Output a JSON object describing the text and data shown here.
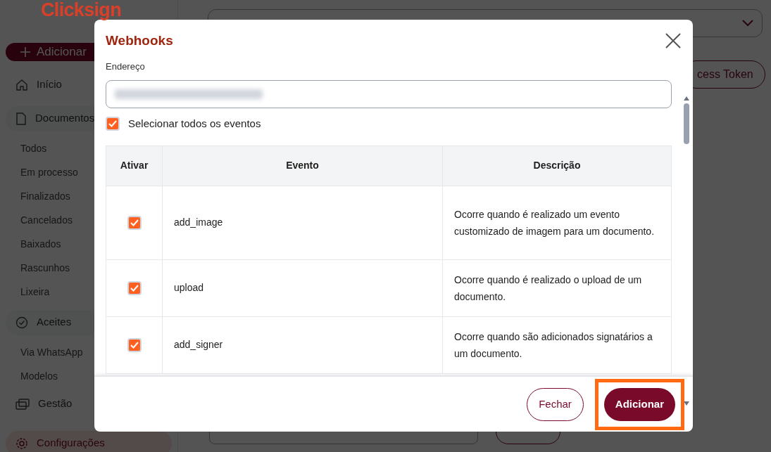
{
  "sidebar": {
    "logo": "Clicksign",
    "add_button": "Adicionar",
    "items": [
      {
        "kind": "link",
        "label": "Início",
        "selected": false
      },
      {
        "kind": "section",
        "label": "Documentos",
        "selected": false
      },
      {
        "kind": "sub",
        "label": "Todos",
        "selected": false
      },
      {
        "kind": "sub",
        "label": "Em processo",
        "selected": false
      },
      {
        "kind": "sub",
        "label": "Finalizados",
        "selected": false
      },
      {
        "kind": "sub",
        "label": "Cancelados",
        "selected": false
      },
      {
        "kind": "sub",
        "label": "Baixados",
        "selected": false
      },
      {
        "kind": "sub",
        "label": "Rascunhos",
        "selected": false
      },
      {
        "kind": "sub",
        "label": "Lixeira",
        "selected": false
      },
      {
        "kind": "section",
        "label": "Aceites",
        "selected": false
      },
      {
        "kind": "sub",
        "label": "Via WhatsApp",
        "selected": false
      },
      {
        "kind": "sub",
        "label": "Modelos",
        "selected": false
      },
      {
        "kind": "link",
        "label": "Gestão",
        "selected": false
      },
      {
        "kind": "link",
        "label": "Configurações",
        "selected": true
      }
    ]
  },
  "main": {
    "token_button": "cess Token"
  },
  "modal": {
    "title": "Webhooks",
    "address_label": "Endereço",
    "select_all": {
      "label": "Selecionar todos os eventos",
      "checked": true
    },
    "columns": [
      "Ativar",
      "Evento",
      "Descrição"
    ],
    "rows": [
      {
        "checked": true,
        "event": "add_image",
        "description": "Ocorre quando é realizado um evento customizado de imagem para um documento."
      },
      {
        "checked": true,
        "event": "upload",
        "description": "Ocorre quando é realizado o upload de um documento."
      },
      {
        "checked": true,
        "event": "add_signer",
        "description": "Ocorre quando são adicionados signatários a um documento."
      }
    ],
    "buttons": [
      {
        "kind": "secondary",
        "label": "Fechar"
      },
      {
        "kind": "primary",
        "label": "Adicionar",
        "highlighted": true
      }
    ]
  }
}
